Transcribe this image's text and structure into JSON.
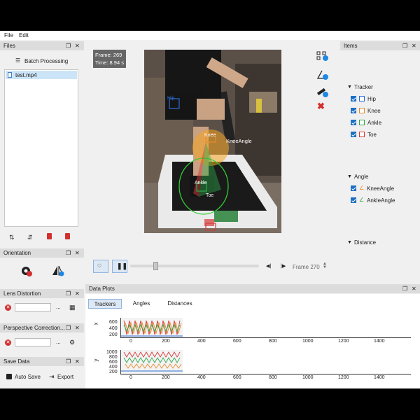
{
  "menu": {
    "file": "File",
    "edit": "Edit"
  },
  "files_panel": {
    "title": "Files",
    "batch_label": "Batch Processing",
    "items": [
      "test.mp4"
    ]
  },
  "orientation_panel": {
    "title": "Orientation"
  },
  "lens_panel": {
    "title": "Lens Distortion",
    "dots": "..."
  },
  "perspective_panel": {
    "title": "Perspective Correction...",
    "dots": "..."
  },
  "save_panel": {
    "title": "Save Data",
    "auto_save": "Auto Save",
    "export": "Export"
  },
  "video": {
    "frame_info": "Frame: 269",
    "time_info": "Time: 8.94 s",
    "labels": {
      "hip": "Hip",
      "knee": "Knee",
      "knee_angle": "KneeAngle",
      "ankle": "Ankle",
      "toe": "Toe"
    }
  },
  "playback": {
    "frame_label": "Frame 270",
    "progress": 0.18
  },
  "items_panel": {
    "title": "Items",
    "tracker_header": "Tracker",
    "trackers": [
      {
        "label": "Hip",
        "color": "#2b6fd6"
      },
      {
        "label": "Knee",
        "color": "#e88a2b"
      },
      {
        "label": "Ankle",
        "color": "#2ea84a"
      },
      {
        "label": "Toe",
        "color": "#d63b3b"
      }
    ],
    "angle_header": "Angle",
    "angles": [
      {
        "label": "KneeAngle"
      },
      {
        "label": "AnkleAngle"
      }
    ],
    "distance_header": "Distance"
  },
  "plots_panel": {
    "title": "Data Plots",
    "tabs": [
      "Trackers",
      "Angles",
      "Distances"
    ],
    "x_ticks": [
      "0",
      "200",
      "400",
      "600",
      "800",
      "1000",
      "1200",
      "1400"
    ],
    "plot_x": {
      "axis_label": "x",
      "y_ticks": [
        "600",
        "400",
        "200"
      ]
    },
    "plot_y": {
      "axis_label": "y",
      "y_ticks": [
        "1000",
        "800",
        "600",
        "400",
        "200"
      ]
    }
  }
}
